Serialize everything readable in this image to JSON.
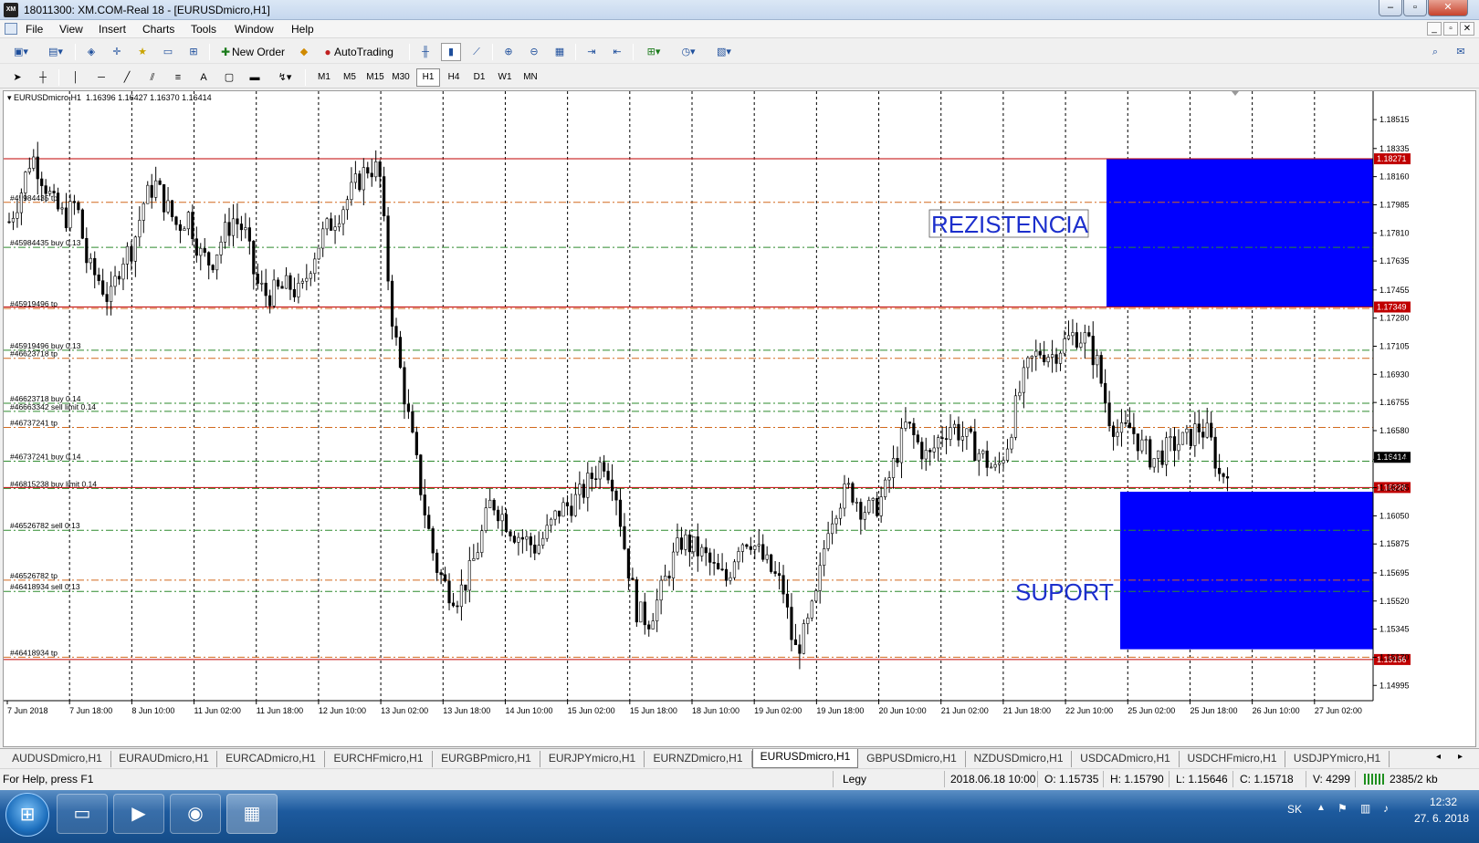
{
  "window": {
    "app_icon": "XM",
    "title": "18011300: XM.COM-Real 18 - [EURUSDmicro,H1]",
    "controls": [
      "–",
      "▫",
      "✕"
    ]
  },
  "menu": [
    "File",
    "View",
    "Insert",
    "Charts",
    "Tools",
    "Window",
    "Help"
  ],
  "toolbar": {
    "new_order": "New Order",
    "autotrading": "AutoTrading",
    "timeframes": [
      "M1",
      "M5",
      "M15",
      "M30",
      "H1",
      "H4",
      "D1",
      "W1",
      "MN"
    ],
    "active_timeframe": "H1",
    "drawing_text_tool": "A"
  },
  "chart_data": {
    "type": "candlestick",
    "header": "EURUSDmicro,H1  1.16396 1.16427 1.16370 1.16414",
    "symbol": "EURUSDmicro",
    "timeframe": "H1",
    "ohlc_last": {
      "open": 1.16396,
      "high": 1.16427,
      "low": 1.1637,
      "close": 1.16414
    },
    "y_ticks": [
      "1.18515",
      "1.18335",
      "1.18160",
      "1.17985",
      "1.17810",
      "1.17635",
      "1.17455",
      "1.17280",
      "1.17105",
      "1.16930",
      "1.16755",
      "1.16580",
      "1.16400",
      "1.16225",
      "1.16050",
      "1.15875",
      "1.15695",
      "1.15520",
      "1.15345",
      "1.15170",
      "1.14995"
    ],
    "ylim": [
      1.149,
      1.1868
    ],
    "x_labels": [
      "7 Jun 2018",
      "7 Jun 18:00",
      "8 Jun 10:00",
      "11 Jun 02:00",
      "11 Jun 18:00",
      "12 Jun 10:00",
      "13 Jun 02:00",
      "13 Jun 18:00",
      "14 Jun 10:00",
      "15 Jun 02:00",
      "15 Jun 18:00",
      "18 Jun 10:00",
      "19 Jun 02:00",
      "19 Jun 18:00",
      "20 Jun 10:00",
      "21 Jun 02:00",
      "21 Jun 18:00",
      "22 Jun 10:00",
      "25 Jun 02:00",
      "25 Jun 18:00",
      "26 Jun 10:00",
      "27 Jun 02:00"
    ],
    "price_path": [
      1.1788,
      1.1805,
      1.183,
      1.1815,
      1.1798,
      1.179,
      1.18,
      1.176,
      1.1752,
      1.1738,
      1.1765,
      1.1772,
      1.18,
      1.1812,
      1.1798,
      1.1785,
      1.1792,
      1.1768,
      1.1762,
      1.1778,
      1.179,
      1.1782,
      1.175,
      1.1742,
      1.1745,
      1.1748,
      1.1742,
      1.1765,
      1.178,
      1.179,
      1.18,
      1.1812,
      1.1822,
      1.182,
      1.1736,
      1.169,
      1.165,
      1.161,
      1.1575,
      1.156,
      1.1555,
      1.1568,
      1.159,
      1.1615,
      1.1605,
      1.1595,
      1.159,
      1.1585,
      1.1595,
      1.1608,
      1.1612,
      1.1618,
      1.163,
      1.164,
      1.1625,
      1.158,
      1.1545,
      1.154,
      1.1555,
      1.1575,
      1.159,
      1.1585,
      1.158,
      1.157,
      1.1565,
      1.1588,
      1.1592,
      1.158,
      1.157,
      1.156,
      1.152,
      1.1532,
      1.1555,
      1.16,
      1.1615,
      1.1622,
      1.161,
      1.1608,
      1.1618,
      1.164,
      1.1662,
      1.165,
      1.164,
      1.1655,
      1.1662,
      1.1655,
      1.1648,
      1.164,
      1.1632,
      1.165,
      1.168,
      1.17,
      1.1708,
      1.1705,
      1.1712,
      1.1718,
      1.1715,
      1.17,
      1.1668,
      1.1655,
      1.166,
      1.1648,
      1.164,
      1.1645,
      1.165,
      1.1652,
      1.166,
      1.1655,
      1.1628,
      1.1641
    ],
    "key_levels": [
      {
        "price": 1.18271,
        "label": "1.18271"
      },
      {
        "price": 1.17349,
        "label": "1.17349"
      },
      {
        "price": 1.16226,
        "label": "1.16226"
      },
      {
        "price": 1.15156,
        "label": "1.15156"
      }
    ],
    "current_price": {
      "price": 1.16414,
      "label": "1.16414"
    },
    "order_lines": [
      {
        "price": 1.18,
        "label": "#45984435 tp",
        "kind": "tp"
      },
      {
        "price": 1.1772,
        "label": "#45984435 buy 0.13",
        "kind": "trade"
      },
      {
        "price": 1.1734,
        "label": "#45919496 tp",
        "kind": "tp"
      },
      {
        "price": 1.1708,
        "label": "#45919496 buy 0.13",
        "kind": "trade"
      },
      {
        "price": 1.1703,
        "label": "#46623718 tp",
        "kind": "tp"
      },
      {
        "price": 1.1675,
        "label": "#46623718 buy 0.14",
        "kind": "trade"
      },
      {
        "price": 1.167,
        "label": "#46663342 sell limit 0.14",
        "kind": "trade"
      },
      {
        "price": 1.166,
        "label": "#46737241 tp",
        "kind": "tp"
      },
      {
        "price": 1.1639,
        "label": "#46737241 buy 0.14",
        "kind": "trade"
      },
      {
        "price": 1.1622,
        "label": "#46815238 buy limit 0.14",
        "kind": "trade"
      },
      {
        "price": 1.1596,
        "label": "#46526782 sell 0.13",
        "kind": "trade"
      },
      {
        "price": 1.1565,
        "label": "#46526782 tp",
        "kind": "tp"
      },
      {
        "price": 1.1558,
        "label": "#46418934 sell 0.13",
        "kind": "trade"
      },
      {
        "price": 1.1517,
        "label": "#46418934 tp",
        "kind": "tp"
      }
    ],
    "zones": [
      {
        "name": "resistance",
        "label": "REZISTENCIA",
        "top": 1.18271,
        "bottom": 1.17349,
        "color": "#0000ff"
      },
      {
        "name": "support",
        "label": "SUPORT",
        "top": 1.162,
        "bottom": 1.1522,
        "color": "#0000ff"
      }
    ],
    "grid": true,
    "colors": {
      "level": "#c00000",
      "tp": "#d2691e",
      "trade": "#2e8b2e",
      "zone": "#0000ff",
      "zone_text": "#1c2fcc",
      "grid": "#000000"
    }
  },
  "symbol_tabs": [
    "AUDUSDmicro,H1",
    "EURAUDmicro,H1",
    "EURCADmicro,H1",
    "EURCHFmicro,H1",
    "EURGBPmicro,H1",
    "EURJPYmicro,H1",
    "EURNZDmicro,H1",
    "EURUSDmicro,H1",
    "GBPUSDmicro,H1",
    "NZDUSDmicro,H1",
    "USDCADmicro,H1",
    "USDCHFmicro,H1",
    "USDJPYmicro,H1"
  ],
  "active_tab": "EURUSDmicro,H1",
  "tab_nav": [
    "◂",
    "▸"
  ],
  "status": {
    "help": "For Help, press F1",
    "profile": "Legy",
    "datetime": "2018.06.18 10:00",
    "open": "O: 1.15735",
    "high": "H: 1.15790",
    "low": "L: 1.15646",
    "close": "C: 1.15718",
    "volume": "V: 4299",
    "traffic": "2385/2 kb"
  },
  "taskbar": {
    "lang": "SK",
    "time": "12:32",
    "date": "27. 6. 2018",
    "apps": [
      "start-orb",
      "explorer",
      "media-player",
      "chrome",
      "metatrader"
    ]
  }
}
